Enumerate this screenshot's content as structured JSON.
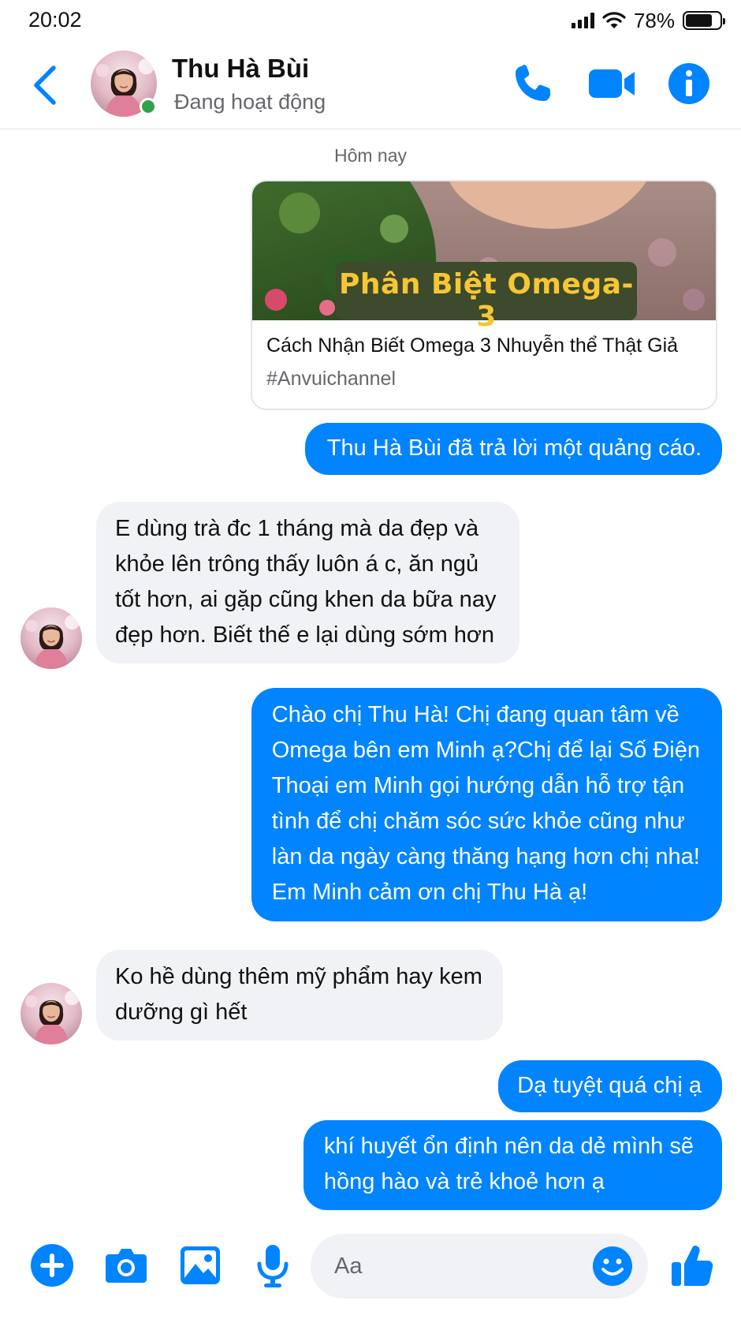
{
  "status_bar": {
    "time": "20:02",
    "battery": "78%",
    "battery_level": 0.78
  },
  "header": {
    "contact_name": "Thu Hà Bùi",
    "contact_status": "Đang hoạt động",
    "icons": [
      "back-icon",
      "phone-icon",
      "video-camera-icon",
      "info-icon"
    ]
  },
  "chat": {
    "date_separator": "Hôm nay",
    "ad_card": {
      "image_caption": "Phân Biệt Omega-3",
      "title": "Cách Nhận Biết Omega 3 Nhuyễn thể Thật Giả",
      "tag": "#Anvuichannel"
    },
    "messages": [
      {
        "from": "me",
        "lines": [
          "Thu Hà Bùi đã trả lời một quảng cáo."
        ]
      },
      {
        "from": "contact",
        "lines": [
          "E dùng trà đc 1 tháng mà da đẹp và",
          "khỏe lên trông thấy luôn á c, ăn ngủ",
          "tốt hơn, ai gặp cũng khen da bữa nay",
          "đẹp hơn. Biết thế e lại dùng sớm hơn"
        ]
      },
      {
        "from": "me",
        "lines": [
          "Chào chị Thu Hà! Chị đang quan tâm về",
          "Omega bên em Minh ạ?Chị để lại Số Điện",
          "Thoại em Minh gọi hướng dẫn hỗ trợ tận",
          "tình để chị chăm sóc sức khỏe cũng như",
          "làn da ngày càng thăng hạng hơn chị nha!",
          "Em Minh cảm ơn chị Thu Hà  ạ!"
        ]
      },
      {
        "from": "contact",
        "lines": [
          "Ko hề dùng thêm mỹ phẩm hay kem",
          "dưỡng gì hết"
        ]
      },
      {
        "from": "me",
        "lines": [
          "Dạ tuyệt quá chị ạ"
        ]
      },
      {
        "from": "me",
        "lines": [
          "khí huyết ổn định nên da dẻ mình sẽ",
          "hồng hào và trẻ khoẻ hơn ạ"
        ]
      }
    ]
  },
  "composer": {
    "placeholder": "Aa",
    "icons": [
      "add-icon",
      "camera-icon",
      "image-icon",
      "microphone-icon",
      "emoji-icon",
      "like-icon"
    ]
  },
  "colors": {
    "accent": "#0084ff",
    "incoming_bubble": "#f0f2f5",
    "online": "#31a24c",
    "muted_text": "#65676b"
  }
}
